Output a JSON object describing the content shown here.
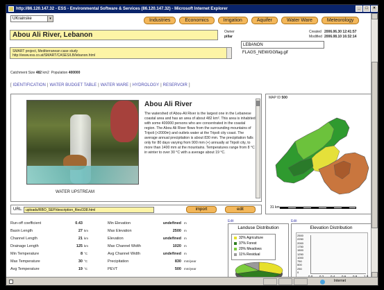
{
  "window": {
    "title": "http://86.120.147.32 - ESS - Environmental Software & Services (86.120.147.32) - Microsoft Internet Explorer"
  },
  "language": {
    "selected": "UKrainske"
  },
  "nav": {
    "tabs": [
      "Industries",
      "Economics",
      "Irrigation",
      "Aquifer",
      "Water Ware",
      "Meteorology"
    ]
  },
  "page": {
    "title": "Abou Ali River, Lebanon",
    "owner_label": "Owner",
    "owner": "pillar",
    "created_label": "Created",
    "created": "2006.06.30 12:41:57",
    "modified_label": "Modified",
    "modified": "2006.08.10 16:32:14"
  },
  "project": {
    "line1": "SMART project, Mediterranean case study",
    "line2": "http://www.ess.co.at/SMART/CASES/LB/lebanon.html"
  },
  "flags": {
    "country": "LEBANON",
    "flag_file": "FLAGS_NEW/GGflag.gif"
  },
  "stats": {
    "catchment_label": "Catchment Size",
    "catchment_value": "482",
    "catchment_unit": "km2",
    "population_label": "Population",
    "population_value": "400000"
  },
  "links": [
    "IDENTIFICATION",
    "WATER BUDGET TABLE",
    "WATER WARE",
    "HYDROLOGY",
    "RESERVOIR"
  ],
  "description": {
    "title": "Abou Ali River",
    "text": "The watershed of Abou-Ali River is the largest one in the Lebanese coastal area and has an area of about 482 km². This area is inhabited with some 400000 persons who are concentrated in the coastal region. The Abou Ali River flows from the surrounding mountains of Tripoli (>2000m) and outlets water at the Tripoli city coast. The average annual precipitation is about 830 mm. The precipitation falls only for 80 days varying from 900 mm (+) annually at Tripoli city, to more than 1400 mm at the mountains. Temperatures range from 8 °C in winter to over 30 °C with a average about 19 °C.",
    "photo_caption": "WATER UPSTREAM"
  },
  "url": {
    "label": "URL:",
    "value": "uploads/RBO_SEP/description_files/338.html",
    "import_label": "import",
    "edit_label": "edit"
  },
  "map": {
    "id_label": "MAP ID",
    "id_value": "500",
    "scale_label": "31 km"
  },
  "params_left": [
    {
      "label": "Run-off coefficient",
      "value": "0.43",
      "unit": ""
    },
    {
      "label": "Basin Length",
      "value": "27",
      "unit": "km"
    },
    {
      "label": "Channel Length",
      "value": "21",
      "unit": "km"
    },
    {
      "label": "Drainage Length",
      "value": "125",
      "unit": "km"
    },
    {
      "label": "Min Temperature",
      "value": "8",
      "unit": "°C"
    },
    {
      "label": "Max Temperature",
      "value": "30",
      "unit": "°C"
    },
    {
      "label": "Avg Temperature",
      "value": "19",
      "unit": "°C"
    }
  ],
  "params_right": [
    {
      "label": "Min Elevation",
      "value": "undefined",
      "unit": "m"
    },
    {
      "label": "Max Elevation",
      "value": "2500",
      "unit": "m"
    },
    {
      "label": "Elevation",
      "value": "undefined",
      "unit": "m"
    },
    {
      "label": "Max Channel Width",
      "value": "1020",
      "unit": "m"
    },
    {
      "label": "Avg Channel Width",
      "value": "undefined",
      "unit": "m"
    },
    {
      "label": "Precipitation",
      "value": "830",
      "unit": "mm/year"
    },
    {
      "label": "PEVT",
      "value": "500",
      "unit": "mm/year"
    }
  ],
  "landuse": {
    "title": "Landuse Distribution",
    "edit_label": "Edit",
    "items": [
      {
        "label": "32% Agriculture",
        "pct": 32,
        "color": "#e7e02b"
      },
      {
        "label": "37% Forest",
        "pct": 37,
        "color": "#2f7d1f"
      },
      {
        "label": "20% Meadows",
        "pct": 20,
        "color": "#7ccc3e"
      },
      {
        "label": "11% Residual",
        "pct": 11,
        "color": "#9a9a9a"
      }
    ]
  },
  "elevation": {
    "title": "Elevation Distribution",
    "edit_label": "Edit",
    "yticks": [
      "2500",
      "2250",
      "2000",
      "1750",
      "1500",
      "1250",
      "1000",
      "750",
      "500",
      "250",
      "0"
    ],
    "xticks": [
      "0.0",
      "0.2",
      "0.4",
      "0.6",
      "0.8",
      "1.0"
    ]
  },
  "status": {
    "zone": "Internet"
  },
  "colors": {
    "accent": "#f3b75a",
    "highlight": "#fdf4a6",
    "link": "#4b4bb0"
  }
}
